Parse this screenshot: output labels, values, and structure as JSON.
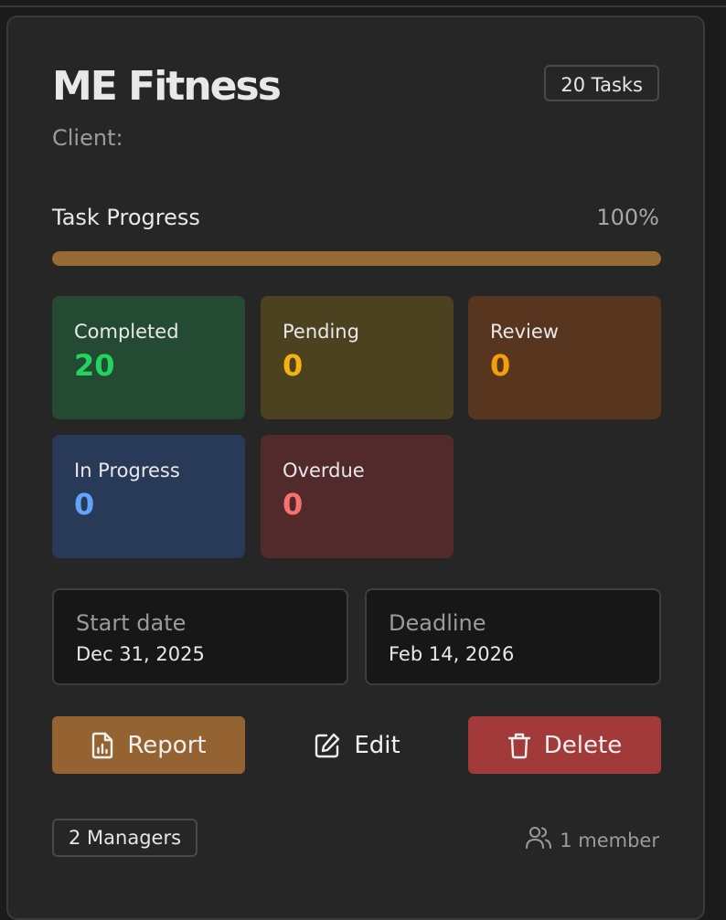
{
  "project": {
    "title": "ME Fitness",
    "task_count_badge": "20 Tasks",
    "client_label": "Client:"
  },
  "progress": {
    "label": "Task Progress",
    "percent_text": "100%",
    "percent": 100,
    "color": "#956b33"
  },
  "stats": [
    {
      "label": "Completed",
      "value": "20",
      "bg": "#254a33",
      "color": "#22d35e"
    },
    {
      "label": "Pending",
      "value": "0",
      "bg": "#4d421f",
      "color": "#f5b014"
    },
    {
      "label": "Review",
      "value": "0",
      "bg": "#58351f",
      "color": "#f59e0b"
    },
    {
      "label": "In Progress",
      "value": "0",
      "bg": "#283a57",
      "color": "#60a5fa"
    },
    {
      "label": "Overdue",
      "value": "0",
      "bg": "#522a2b",
      "color": "#f87171"
    }
  ],
  "dates": {
    "start_label": "Start date",
    "start_value": "Dec 31, 2025",
    "deadline_label": "Deadline",
    "deadline_value": "Feb 14, 2026"
  },
  "actions": {
    "report_label": "Report",
    "edit_label": "Edit",
    "delete_label": "Delete",
    "report_icon": "file-chart-icon",
    "edit_icon": "edit-icon",
    "delete_icon": "trash-icon",
    "report_color": "#956332",
    "delete_color": "#a23a3a"
  },
  "footer": {
    "managers_badge": "2 Managers",
    "members_text": "1 member",
    "members_icon": "users-icon"
  }
}
